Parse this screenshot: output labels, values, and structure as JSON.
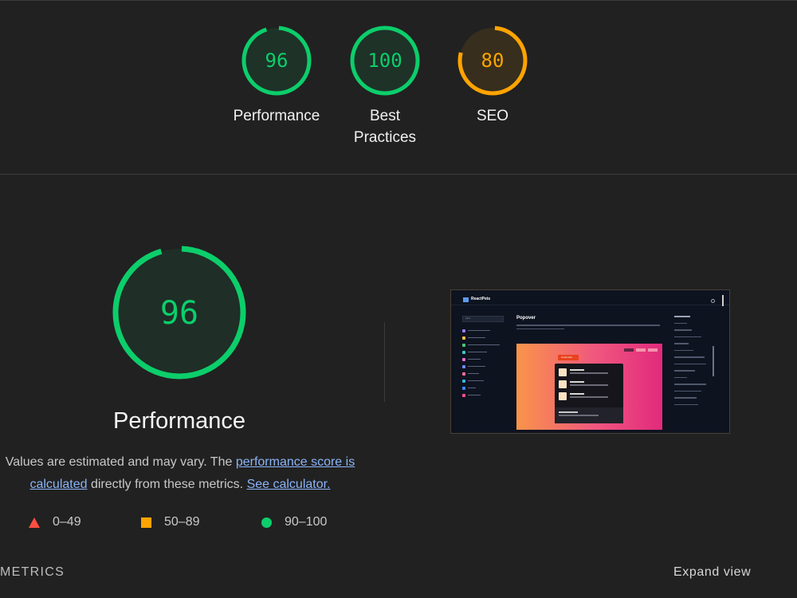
{
  "summary_gauges": [
    {
      "score": "96",
      "label_lines": [
        "Performance"
      ],
      "color": "#0cce6b",
      "fill_fraction": 0.96
    },
    {
      "score": "100",
      "label_lines": [
        "Best",
        "Practices"
      ],
      "color": "#0cce6b",
      "fill_fraction": 1.0
    },
    {
      "score": "80",
      "label_lines": [
        "SEO"
      ],
      "color": "#ffa400",
      "fill_fraction": 0.8
    }
  ],
  "performance": {
    "score": "96",
    "fill_fraction": 0.96,
    "title": "Performance",
    "desc_prefix": "Values are estimated and may vary. The ",
    "desc_link1": "performance score is calculated",
    "desc_middle": " directly from these metrics. ",
    "desc_link2": "See calculator."
  },
  "legend": [
    {
      "icon": "triangle-fail-icon",
      "range": "0–49",
      "color": "#ff4e42"
    },
    {
      "icon": "square-average-icon",
      "range": "50–89",
      "color": "#ffa400"
    },
    {
      "icon": "circle-pass-icon",
      "range": "90–100",
      "color": "#0cce6b"
    }
  ],
  "metrics_heading": "METRICS",
  "expand_view": "Expand view",
  "screenshot": {
    "brand": "ReactPets",
    "search_placeholder": "Find",
    "page_title": "Popover",
    "button_label": "Customize"
  },
  "colors": {
    "pass": "#0cce6b",
    "average": "#ffa400",
    "fail": "#ff4e42",
    "link": "#8ab4f8",
    "background": "#212121"
  }
}
